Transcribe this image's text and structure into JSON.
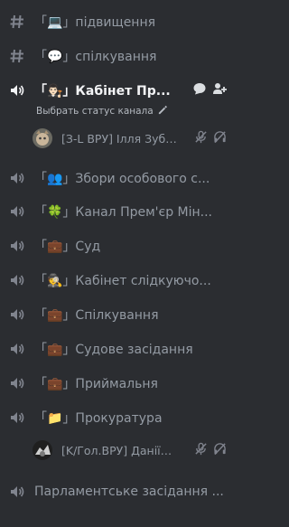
{
  "channels": [
    {
      "type": "text",
      "label": "「💻」підвищення"
    },
    {
      "type": "text",
      "label": "「💬」спілкування"
    },
    {
      "type": "voice",
      "label": "「👨🏻‍⚖️」Кабінет Пр...",
      "active": true
    },
    {
      "type": "voice",
      "label": "「👥」Збори особового с..."
    },
    {
      "type": "voice",
      "label": "「🍀」Канал Прем'єр Мін..."
    },
    {
      "type": "voice",
      "label": "「💼」Суд"
    },
    {
      "type": "voice",
      "label": "「🕵️」Кабінет слідкуючо..."
    },
    {
      "type": "voice",
      "label": "「💼」Спілкування"
    },
    {
      "type": "voice",
      "label": "「💼」Судове засідання"
    },
    {
      "type": "voice",
      "label": "「💼」Приймальня"
    },
    {
      "type": "voice",
      "label": "「📁」Прокуратура"
    },
    {
      "type": "voice",
      "label": "Парламентське засідання ..."
    }
  ],
  "status_text": "Выбрать статус канала",
  "users": [
    {
      "name": "[З-L ВРУ] Ілля Зубов"
    },
    {
      "name": "[K/Гол.ВРУ] Даніїл ..."
    }
  ]
}
